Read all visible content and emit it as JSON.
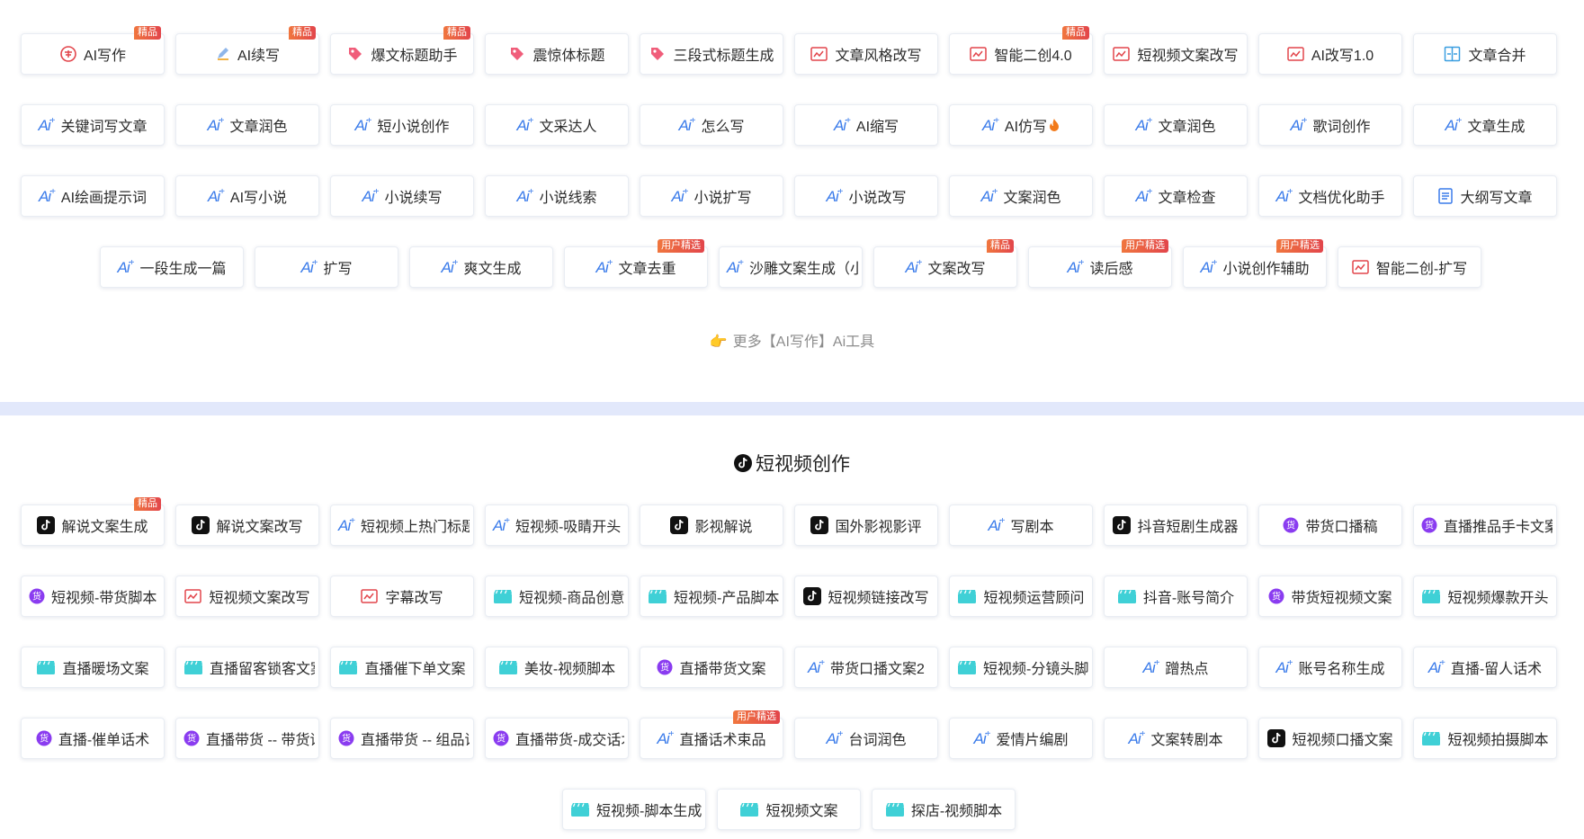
{
  "section1": {
    "rows": [
      [
        {
          "label": "AI写作",
          "icon": "ai-write-icon",
          "badge": "精品"
        },
        {
          "label": "AI续写",
          "icon": "pencil-icon",
          "badge": "精品"
        },
        {
          "label": "爆文标题助手",
          "icon": "tag-icon",
          "badge": "精品"
        },
        {
          "label": "震惊体标题",
          "icon": "tag-icon"
        },
        {
          "label": "三段式标题生成",
          "icon": "tag-icon"
        },
        {
          "label": "文章风格改写",
          "icon": "rewrite-icon"
        },
        {
          "label": "智能二创4.0",
          "icon": "rewrite-icon",
          "badge": "精品"
        },
        {
          "label": "短视频文案改写",
          "icon": "rewrite-icon"
        },
        {
          "label": "AI改写1.0",
          "icon": "rewrite-icon"
        },
        {
          "label": "文章合并",
          "icon": "merge-icon"
        }
      ],
      [
        {
          "label": "关键词写文章",
          "icon": "ai-icon"
        },
        {
          "label": "文章润色",
          "icon": "ai-icon"
        },
        {
          "label": "短小说创作",
          "icon": "ai-icon"
        },
        {
          "label": "文采达人",
          "icon": "ai-icon"
        },
        {
          "label": "怎么写",
          "icon": "ai-icon"
        },
        {
          "label": "AI缩写",
          "icon": "ai-icon"
        },
        {
          "label": "AI仿写",
          "icon": "ai-icon",
          "flame": true
        },
        {
          "label": "文章润色",
          "icon": "ai-icon"
        },
        {
          "label": "歌词创作",
          "icon": "ai-icon"
        },
        {
          "label": "文章生成",
          "icon": "ai-icon"
        }
      ],
      [
        {
          "label": "AI绘画提示词",
          "icon": "ai-icon"
        },
        {
          "label": "AI写小说",
          "icon": "ai-icon"
        },
        {
          "label": "小说续写",
          "icon": "ai-icon"
        },
        {
          "label": "小说线索",
          "icon": "ai-icon"
        },
        {
          "label": "小说扩写",
          "icon": "ai-icon"
        },
        {
          "label": "小说改写",
          "icon": "ai-icon"
        },
        {
          "label": "文案润色",
          "icon": "ai-icon"
        },
        {
          "label": "文章检查",
          "icon": "ai-icon"
        },
        {
          "label": "文档优化助手",
          "icon": "ai-icon"
        },
        {
          "label": "大纲写文章",
          "icon": "outline-icon"
        }
      ],
      [
        {
          "label": "一段生成一篇",
          "icon": "ai-icon"
        },
        {
          "label": "扩写",
          "icon": "ai-icon"
        },
        {
          "label": "爽文生成",
          "icon": "ai-icon"
        },
        {
          "label": "文章去重",
          "icon": "ai-icon",
          "badge": "用户精选"
        },
        {
          "label": "沙雕文案生成（小",
          "icon": "ai-icon"
        },
        {
          "label": "文案改写",
          "icon": "ai-icon",
          "badge": "精品"
        },
        {
          "label": "读后感",
          "icon": "ai-icon",
          "badge": "用户精选"
        },
        {
          "label": "小说创作辅助",
          "icon": "ai-icon",
          "badge": "用户精选"
        },
        {
          "label": "智能二创-扩写",
          "icon": "rewrite-icon"
        }
      ]
    ],
    "more_link": "更多【AI写作】Ai工具"
  },
  "section2": {
    "title": "短视频创作",
    "rows": [
      [
        {
          "label": "解说文案生成",
          "icon": "tiktok-icon",
          "badge": "精品"
        },
        {
          "label": "解说文案改写",
          "icon": "tiktok-icon"
        },
        {
          "label": "短视频上热门标题",
          "icon": "ai-icon"
        },
        {
          "label": "短视频-吸睛开头",
          "icon": "ai-icon"
        },
        {
          "label": "影视解说",
          "icon": "tiktok-icon"
        },
        {
          "label": "国外影视影评",
          "icon": "tiktok-icon"
        },
        {
          "label": "写剧本",
          "icon": "ai-icon"
        },
        {
          "label": "抖音短剧生成器",
          "icon": "tiktok-icon"
        },
        {
          "label": "带货口播稿",
          "icon": "goods-icon"
        },
        {
          "label": "直播推品手卡文案",
          "icon": "goods-icon"
        }
      ],
      [
        {
          "label": "短视频-带货脚本",
          "icon": "goods-icon"
        },
        {
          "label": "短视频文案改写",
          "icon": "rewrite-icon"
        },
        {
          "label": "字幕改写",
          "icon": "rewrite-icon"
        },
        {
          "label": "短视频-商品创意",
          "icon": "clapper-icon"
        },
        {
          "label": "短视频-产品脚本",
          "icon": "clapper-icon"
        },
        {
          "label": "短视频链接改写",
          "icon": "tiktok-icon"
        },
        {
          "label": "短视频运营顾问",
          "icon": "clapper-icon"
        },
        {
          "label": "抖音-账号简介",
          "icon": "clapper-icon"
        },
        {
          "label": "带货短视频文案",
          "icon": "goods-icon"
        },
        {
          "label": "短视频爆款开头",
          "icon": "clapper-icon"
        }
      ],
      [
        {
          "label": "直播暖场文案",
          "icon": "clapper-icon"
        },
        {
          "label": "直播留客锁客文案",
          "icon": "clapper-icon"
        },
        {
          "label": "直播催下单文案",
          "icon": "clapper-icon"
        },
        {
          "label": "美妆-视频脚本",
          "icon": "clapper-icon"
        },
        {
          "label": "直播带货文案",
          "icon": "goods-icon"
        },
        {
          "label": "带货口播文案2",
          "icon": "ai-icon"
        },
        {
          "label": "短视频-分镜头脚本",
          "icon": "clapper-icon"
        },
        {
          "label": "蹭热点",
          "icon": "ai-icon"
        },
        {
          "label": "账号名称生成",
          "icon": "ai-icon"
        },
        {
          "label": "直播-留人话术",
          "icon": "ai-icon"
        }
      ],
      [
        {
          "label": "直播-催单话术",
          "icon": "goods-icon"
        },
        {
          "label": "直播带货 -- 带货话术",
          "icon": "goods-icon"
        },
        {
          "label": "直播带货 -- 组品话术",
          "icon": "goods-icon"
        },
        {
          "label": "直播带货-成交话术",
          "icon": "goods-icon"
        },
        {
          "label": "直播话术束品",
          "icon": "ai-icon",
          "badge": "用户精选"
        },
        {
          "label": "台词润色",
          "icon": "ai-icon"
        },
        {
          "label": "爱情片编剧",
          "icon": "ai-icon"
        },
        {
          "label": "文案转剧本",
          "icon": "ai-icon"
        },
        {
          "label": "短视频口播文案",
          "icon": "tiktok-icon"
        },
        {
          "label": "短视频拍摄脚本",
          "icon": "clapper-icon"
        }
      ],
      [
        {
          "label": "短视频-脚本生成",
          "icon": "clapper-icon"
        },
        {
          "label": "短视频文案",
          "icon": "clapper-icon"
        },
        {
          "label": "探店-视频脚本",
          "icon": "clapper-icon"
        }
      ]
    ]
  }
}
